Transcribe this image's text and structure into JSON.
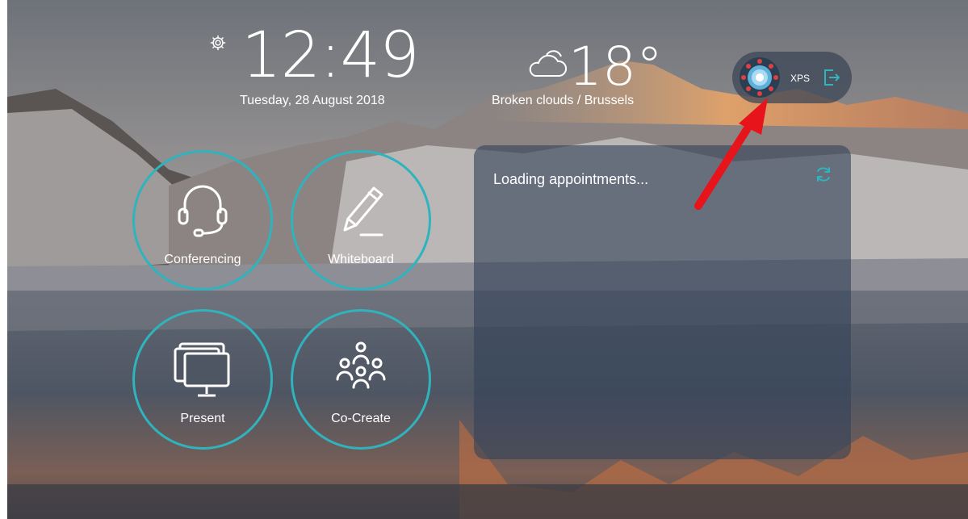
{
  "clock": {
    "time": "12:49",
    "date": "Tuesday, 28 August 2018"
  },
  "weather": {
    "temperature": "18°",
    "description": "Broken clouds / Brussels"
  },
  "user": {
    "name": "XPS"
  },
  "tiles": [
    {
      "label": "Conferencing",
      "icon": "headset-icon"
    },
    {
      "label": "Whiteboard",
      "icon": "pen-icon"
    },
    {
      "label": "Present",
      "icon": "monitor-icon"
    },
    {
      "label": "Co-Create",
      "icon": "people-icon"
    }
  ],
  "appointments": {
    "status": "Loading appointments..."
  },
  "colors": {
    "accent": "#2fb3bd",
    "arrow": "#e8141b",
    "panel": "#344258"
  }
}
